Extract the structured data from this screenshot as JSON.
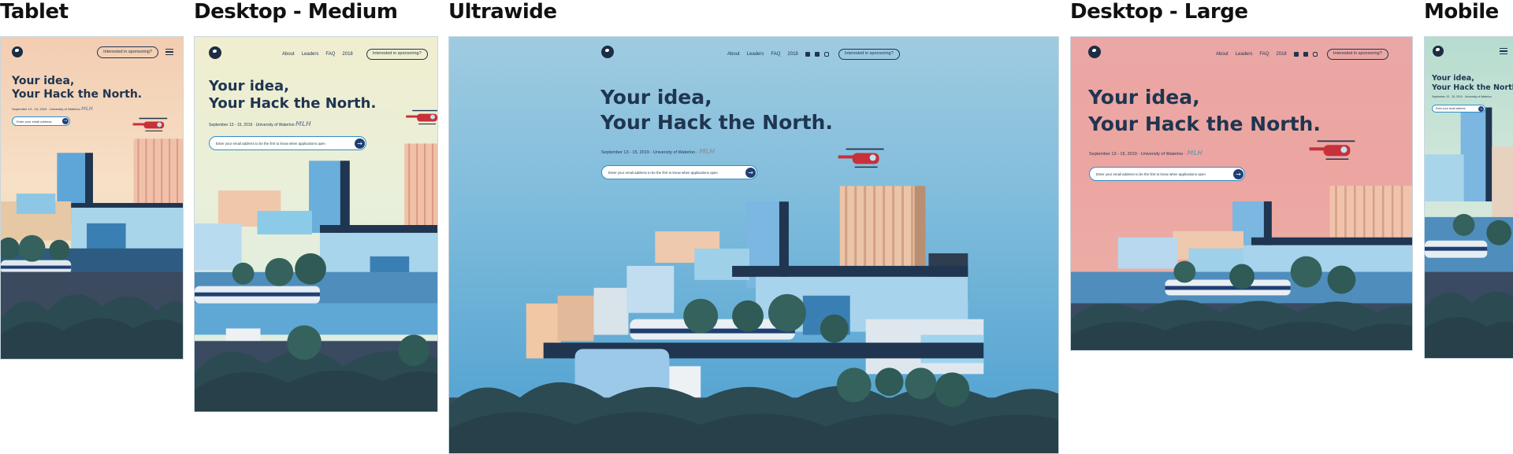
{
  "frames": {
    "tablet": {
      "label": "Tablet"
    },
    "desktop_medium": {
      "label": "Desktop - Medium"
    },
    "ultrawide": {
      "label": "Ultrawide"
    },
    "desktop_large": {
      "label": "Desktop - Large"
    },
    "mobile": {
      "label": "Mobile"
    }
  },
  "nav": {
    "about": "About",
    "leaders": "Leaders",
    "faq": "FAQ",
    "year": "2018",
    "sponsor": "Interested in sponsoring?",
    "social_icons": [
      "facebook-icon",
      "twitter-icon",
      "instagram-icon"
    ]
  },
  "hero": {
    "line1": "Your idea,",
    "line2": "Your Hack the North.",
    "date": "September 13 - 15, 2019",
    "date_short": "September 13 - 15, 2019",
    "location": "University of Waterloo",
    "separator": "·",
    "mlh": "MLH",
    "email_placeholder": "Enter your email address to be the first to know when applications open",
    "email_placeholder_short": "Enter your email address"
  },
  "colors": {
    "navy": "#1f3550",
    "accent_blue": "#2f8fca",
    "tablet_sky": "#f3cdb2",
    "medium_sky": "#f0eecf",
    "ultrawide_sky": "#7fbcdc",
    "large_sky": "#eaa7a5",
    "mobile_sky": "#b6dccf"
  }
}
